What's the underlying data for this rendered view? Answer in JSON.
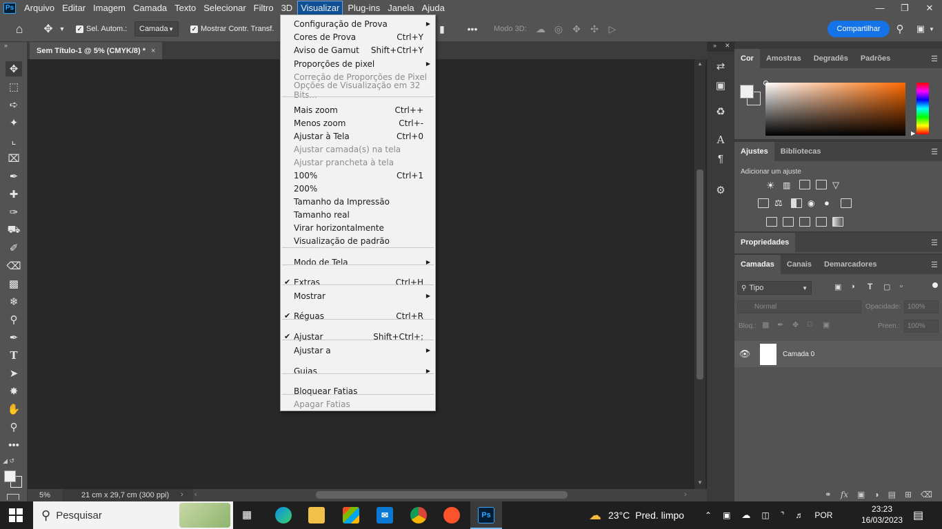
{
  "app": {
    "logo": "Ps"
  },
  "menubar": {
    "items": [
      "Arquivo",
      "Editar",
      "Imagem",
      "Camada",
      "Texto",
      "Selecionar",
      "Filtro",
      "3D",
      "Visualizar",
      "Plug-ins",
      "Janela",
      "Ajuda"
    ],
    "active": "Visualizar"
  },
  "window_controls": {
    "minimize": "—",
    "restore": "❐",
    "close": "✕"
  },
  "options": {
    "auto_select_label": "Sel. Autom.:",
    "auto_select_value": "Camada",
    "show_transform_label": "Mostrar Contr. Transf.",
    "mode_3d_label": "Modo 3D:",
    "share_label": "Compartilhar"
  },
  "document": {
    "tab_title": "Sem Título-1 @ 5% (CMYK/8) *",
    "tab_close": "×",
    "zoom": "5%",
    "doc_info": "21 cm x 29,7 cm (300 ppi)"
  },
  "dropdown": {
    "items": [
      {
        "label": "Configuração de Prova",
        "shortcut": "",
        "submenu": true,
        "disabled": false,
        "checked": false
      },
      {
        "label": "Cores de Prova",
        "shortcut": "Ctrl+Y",
        "submenu": false,
        "disabled": false,
        "checked": false
      },
      {
        "label": "Aviso de Gamut",
        "shortcut": "Shift+Ctrl+Y",
        "submenu": false,
        "disabled": false,
        "checked": false
      },
      {
        "label": "Proporções de pixel",
        "shortcut": "",
        "submenu": true,
        "disabled": false,
        "checked": false
      },
      {
        "label": "Correção de Proporções de Pixel",
        "shortcut": "",
        "submenu": false,
        "disabled": true,
        "checked": false
      },
      {
        "label": "Opções de Visualização em 32 Bits...",
        "shortcut": "",
        "submenu": false,
        "disabled": true,
        "checked": false
      },
      {
        "label": "Mais zoom",
        "shortcut": "Ctrl++",
        "submenu": false,
        "disabled": false,
        "checked": false
      },
      {
        "label": "Menos zoom",
        "shortcut": "Ctrl+-",
        "submenu": false,
        "disabled": false,
        "checked": false
      },
      {
        "label": "Ajustar à Tela",
        "shortcut": "Ctrl+0",
        "submenu": false,
        "disabled": false,
        "checked": false
      },
      {
        "label": "Ajustar camada(s) na tela",
        "shortcut": "",
        "submenu": false,
        "disabled": true,
        "checked": false
      },
      {
        "label": "Ajustar prancheta à tela",
        "shortcut": "",
        "submenu": false,
        "disabled": true,
        "checked": false
      },
      {
        "label": "100%",
        "shortcut": "Ctrl+1",
        "submenu": false,
        "disabled": false,
        "checked": false
      },
      {
        "label": "200%",
        "shortcut": "",
        "submenu": false,
        "disabled": false,
        "checked": false
      },
      {
        "label": "Tamanho da Impressão",
        "shortcut": "",
        "submenu": false,
        "disabled": false,
        "checked": false
      },
      {
        "label": "Tamanho real",
        "shortcut": "",
        "submenu": false,
        "disabled": false,
        "checked": false
      },
      {
        "label": "Virar horizontalmente",
        "shortcut": "",
        "submenu": false,
        "disabled": false,
        "checked": false
      },
      {
        "label": "Visualização de padrão",
        "shortcut": "",
        "submenu": false,
        "disabled": false,
        "checked": false
      },
      {
        "label": "Modo de Tela",
        "shortcut": "",
        "submenu": true,
        "disabled": false,
        "checked": false
      },
      {
        "label": "Extras",
        "shortcut": "Ctrl+H",
        "submenu": false,
        "disabled": false,
        "checked": true
      },
      {
        "label": "Mostrar",
        "shortcut": "",
        "submenu": true,
        "disabled": false,
        "checked": false
      },
      {
        "label": "Réguas",
        "shortcut": "Ctrl+R",
        "submenu": false,
        "disabled": false,
        "checked": true
      },
      {
        "label": "Ajustar",
        "shortcut": "Shift+Ctrl+;",
        "submenu": false,
        "disabled": false,
        "checked": true
      },
      {
        "label": "Ajustar a",
        "shortcut": "",
        "submenu": true,
        "disabled": false,
        "checked": false
      },
      {
        "label": "Guias",
        "shortcut": "",
        "submenu": true,
        "disabled": false,
        "checked": false
      },
      {
        "label": "Bloquear Fatias",
        "shortcut": "",
        "submenu": false,
        "disabled": false,
        "checked": false
      },
      {
        "label": "Apagar Fatias",
        "shortcut": "",
        "submenu": false,
        "disabled": true,
        "checked": false
      }
    ]
  },
  "panels": {
    "color_tabs": [
      "Cor",
      "Amostras",
      "Degradês",
      "Padrões"
    ],
    "adjust_tabs": [
      "Ajustes",
      "Bibliotecas"
    ],
    "adjust_hint": "Adicionar um ajuste",
    "properties_tab": "Propriedades",
    "layers_tabs": [
      "Camadas",
      "Canais",
      "Demarcadores"
    ],
    "layer_filter": "Tipo",
    "blend_mode": "Normal",
    "opacity_label": "Opacidade:",
    "opacity_value": "100%",
    "lock_label": "Bloq.:",
    "fill_label": "Preen.:",
    "fill_value": "100%",
    "layer_name": "Camada 0"
  },
  "taskbar": {
    "search_placeholder": "Pesquisar",
    "weather_temp": "23°C",
    "weather_desc": "Pred. limpo",
    "language": "POR",
    "time": "23:23",
    "date": "16/03/2023"
  }
}
